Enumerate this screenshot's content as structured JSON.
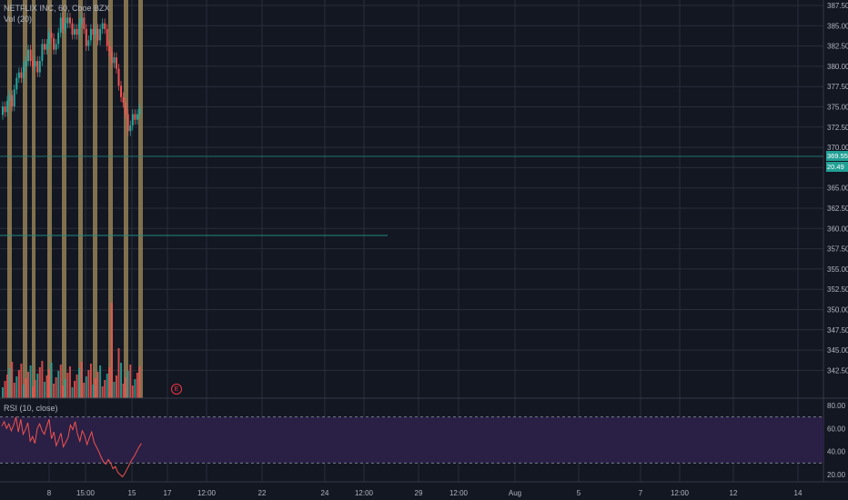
{
  "title": "NETFLIX INC, 60, Cboe BZX",
  "vol_label": "Vol (20)",
  "rsi_label": "RSI (10, close)",
  "earnings_marker": "E",
  "price_axis": [
    "387.50",
    "385.00",
    "382.50",
    "380.00",
    "377.50",
    "375.00",
    "372.50",
    "370.00",
    "367.50",
    "365.00",
    "362.50",
    "360.00",
    "357.50",
    "355.00",
    "352.50",
    "350.00",
    "347.50",
    "345.00",
    "342.50"
  ],
  "rsi_axis": [
    "80.00",
    "60.00",
    "40.00",
    "20.00"
  ],
  "last_price": "369.55",
  "rsi_value": "20.49",
  "time_axis": [
    "8",
    "15:00",
    "15",
    "17",
    "12:00",
    "22",
    "24",
    "12:00",
    "29",
    "12:00",
    "Aug",
    "5",
    "7",
    "12:00",
    "12",
    "14"
  ],
  "horizontal_line_price": 360.0,
  "colors": {
    "background": "#131722",
    "grid": "#2a2e39",
    "up": "#26a69a",
    "down": "#ef5350",
    "highlight": "#a68f5c",
    "rsi_band": "#2a1f45",
    "hline": "#1f8a82"
  }
}
